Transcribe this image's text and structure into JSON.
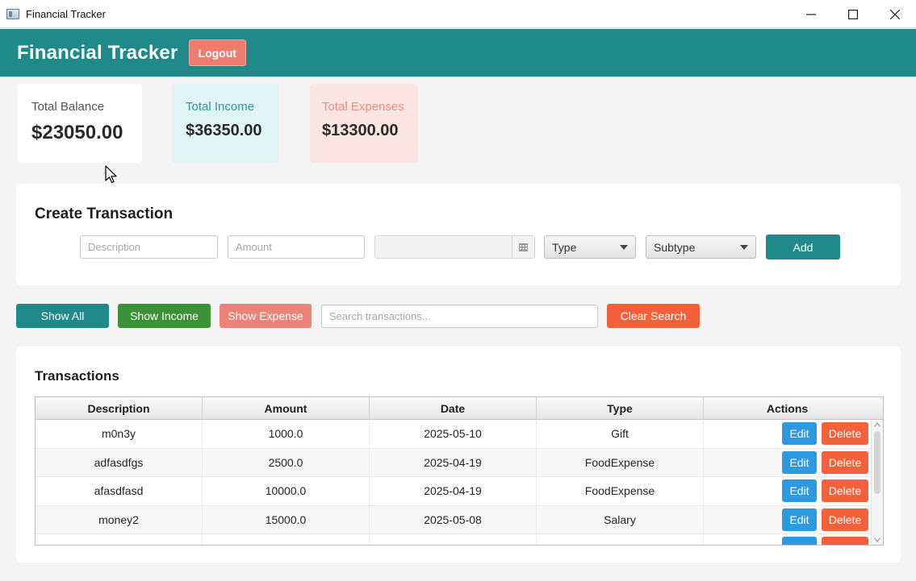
{
  "window": {
    "title": "Financial Tracker",
    "controls": [
      "minimize-icon",
      "maximize-icon",
      "close-icon"
    ]
  },
  "header": {
    "title": "Financial Tracker",
    "logout_label": "Logout",
    "color": "#208a8a"
  },
  "summary": {
    "balance": {
      "label": "Total Balance",
      "value": "$23050.00"
    },
    "income": {
      "label": "Total Income",
      "value": "$36350.00"
    },
    "expenses": {
      "label": "Total Expenses",
      "value": "$13300.00"
    }
  },
  "create": {
    "title": "Create Transaction",
    "description_placeholder": "Description",
    "amount_placeholder": "Amount",
    "date_value": "",
    "type_value": "Type",
    "subtype_value": "Subtype",
    "add_label": "Add"
  },
  "filters": {
    "show_all": "Show All",
    "show_income": "Show Income",
    "show_expense": "Show Expense",
    "search_placeholder": "Search transactions...",
    "clear_search": "Clear Search"
  },
  "transactions": {
    "title": "Transactions",
    "columns": [
      "Description",
      "Amount",
      "Date",
      "Type",
      "Actions"
    ],
    "rows": [
      {
        "description": "m0n3y",
        "amount": "1000.0",
        "date": "2025-05-10",
        "type": "Gift"
      },
      {
        "description": "adfasdfgs",
        "amount": "2500.0",
        "date": "2025-04-19",
        "type": "FoodExpense"
      },
      {
        "description": "afasdfasd",
        "amount": "10000.0",
        "date": "2025-04-19",
        "type": "FoodExpense"
      },
      {
        "description": "money2",
        "amount": "15000.0",
        "date": "2025-05-08",
        "type": "Salary"
      }
    ],
    "edit_label": "Edit",
    "delete_label": "Delete"
  },
  "colors": {
    "accent": "#208a8a",
    "income_green": "#3b9136",
    "expense_pink": "#ec837a",
    "danger": "#f4603a",
    "edit_blue": "#2c9ae0"
  }
}
